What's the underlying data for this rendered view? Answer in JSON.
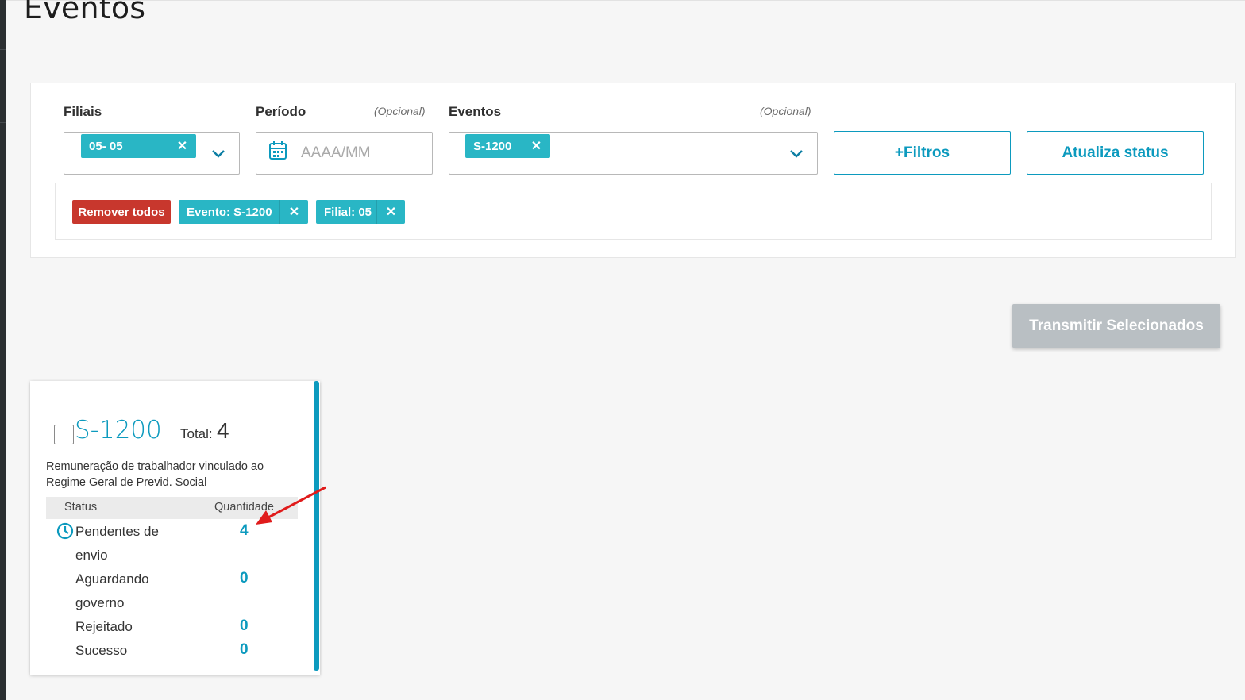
{
  "page": {
    "title": "Eventos"
  },
  "filters": {
    "filiais": {
      "label": "Filiais",
      "chip": "05- 05"
    },
    "periodo": {
      "label": "Período",
      "optional": "(Opcional)",
      "placeholder": "AAAA/MM"
    },
    "eventos": {
      "label": "Eventos",
      "optional": "(Opcional)",
      "chip": "S-1200"
    },
    "more_filters_label": "+Filtros",
    "update_status_label": "Atualiza status"
  },
  "active_filters": {
    "remove_all_label": "Remover todos",
    "tags": [
      "Evento: S-1200",
      "Filial: 05"
    ]
  },
  "transmit_label": "Transmitir Selecionados",
  "card": {
    "code": "S-1200",
    "total_label": "Total:",
    "total_value": "4",
    "description": "Remuneração de trabalhador vinculado ao Regime Geral de Previd. Social",
    "col_status": "Status",
    "col_quantity": "Quantidade",
    "rows": [
      {
        "label": "Pendentes de envio",
        "value": "4"
      },
      {
        "label": "Aguardando governo",
        "value": "0"
      },
      {
        "label": "Rejeitado",
        "value": "0"
      },
      {
        "label": "Sucesso",
        "value": "0"
      }
    ]
  },
  "colors": {
    "accent": "#0c9abe",
    "chip": "#29b6c5",
    "danger": "#c8372d",
    "disabled": "#b9bfc3",
    "annotation": "#e01b1b"
  },
  "icons": [
    "calendar-icon",
    "chevron-down-icon",
    "close-icon",
    "clock-icon",
    "arrow-annotation"
  ]
}
